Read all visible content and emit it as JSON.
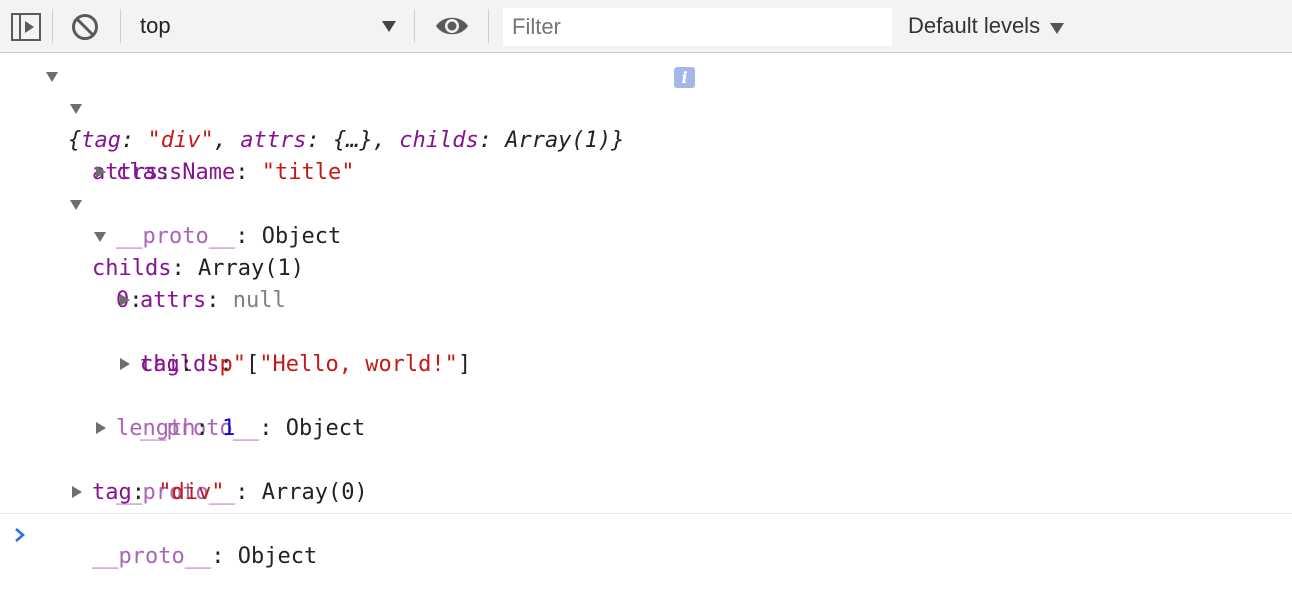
{
  "toolbar": {
    "context": "top",
    "filter_placeholder": "Filter",
    "levels_label": "Default levels",
    "icons": [
      "sidebar-toggle-icon",
      "clear-console-icon",
      "eye-icon"
    ]
  },
  "console": {
    "summary": {
      "open": "{",
      "k1": "tag",
      "v1": "\"div\"",
      "k2": "attrs",
      "v2": "{…}",
      "k3": "childs",
      "v3": "Array(1)",
      "close": "}",
      "badge": "i"
    },
    "attrs_key": "attrs",
    "classname_key": "className",
    "classname_val": "\"title\"",
    "proto_key": "__proto__",
    "object_val": "Object",
    "childs_key": "childs",
    "childs_val": "Array(1)",
    "index0_key": "0",
    "inner_attrs_key": "attrs",
    "null_val": "null",
    "inner_childs_key": "childs",
    "inner_childs_open": "[",
    "inner_childs_str": "\"Hello, world!\"",
    "inner_childs_close": "]",
    "inner_tag_key": "tag",
    "inner_tag_val": "\"p\"",
    "length_key": "length",
    "length_val": "1",
    "array0_val": "Array(0)",
    "tag_key": "tag",
    "tag_val": "\"div\"",
    "colon": ":"
  },
  "colors": {
    "key": "#881391",
    "key_dim": "#a866b4",
    "string": "#c41a16",
    "number": "#1c00cf",
    "prompt": "#2f6fe0"
  }
}
